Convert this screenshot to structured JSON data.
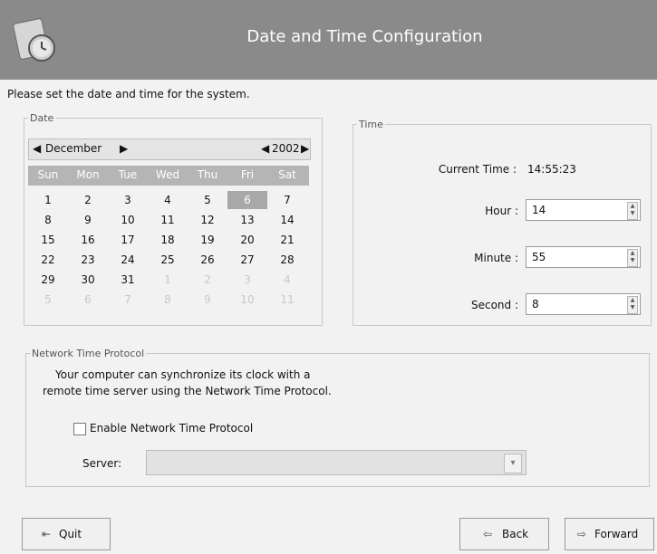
{
  "window": {
    "title": "Date and Time Configuration"
  },
  "intro": "Please set the date and time for the system.",
  "date": {
    "legend": "Date",
    "month": "December",
    "year": "2002",
    "weekdays": [
      "Sun",
      "Mon",
      "Tue",
      "Wed",
      "Thu",
      "Fri",
      "Sat"
    ],
    "selected_day": "6",
    "rows": [
      [
        "1",
        "2",
        "3",
        "4",
        "5",
        "6",
        "7"
      ],
      [
        "8",
        "9",
        "10",
        "11",
        "12",
        "13",
        "14"
      ],
      [
        "15",
        "16",
        "17",
        "18",
        "19",
        "20",
        "21"
      ],
      [
        "22",
        "23",
        "24",
        "25",
        "26",
        "27",
        "28"
      ],
      [
        "29",
        "30",
        "31",
        "1",
        "2",
        "3",
        "4"
      ],
      [
        "5",
        "6",
        "7",
        "8",
        "9",
        "10",
        "11"
      ]
    ],
    "dim_from_row4_col": 3
  },
  "time": {
    "legend": "Time",
    "current_label": "Current Time :",
    "current_value": "14:55:23",
    "hour_label": "Hour :",
    "hour_value": "14",
    "minute_label": "Minute :",
    "minute_value": "55",
    "second_label": "Second :",
    "second_value": "8"
  },
  "ntp": {
    "legend": "Network Time Protocol",
    "line1": "Your computer can synchronize its clock with a",
    "line2": "remote time server using the Network Time Protocol.",
    "enable_label": "Enable Network Time Protocol",
    "enabled": false,
    "server_label": "Server:",
    "server_value": ""
  },
  "buttons": {
    "quit": "Quit",
    "back": "Back",
    "forward": "Forward"
  }
}
